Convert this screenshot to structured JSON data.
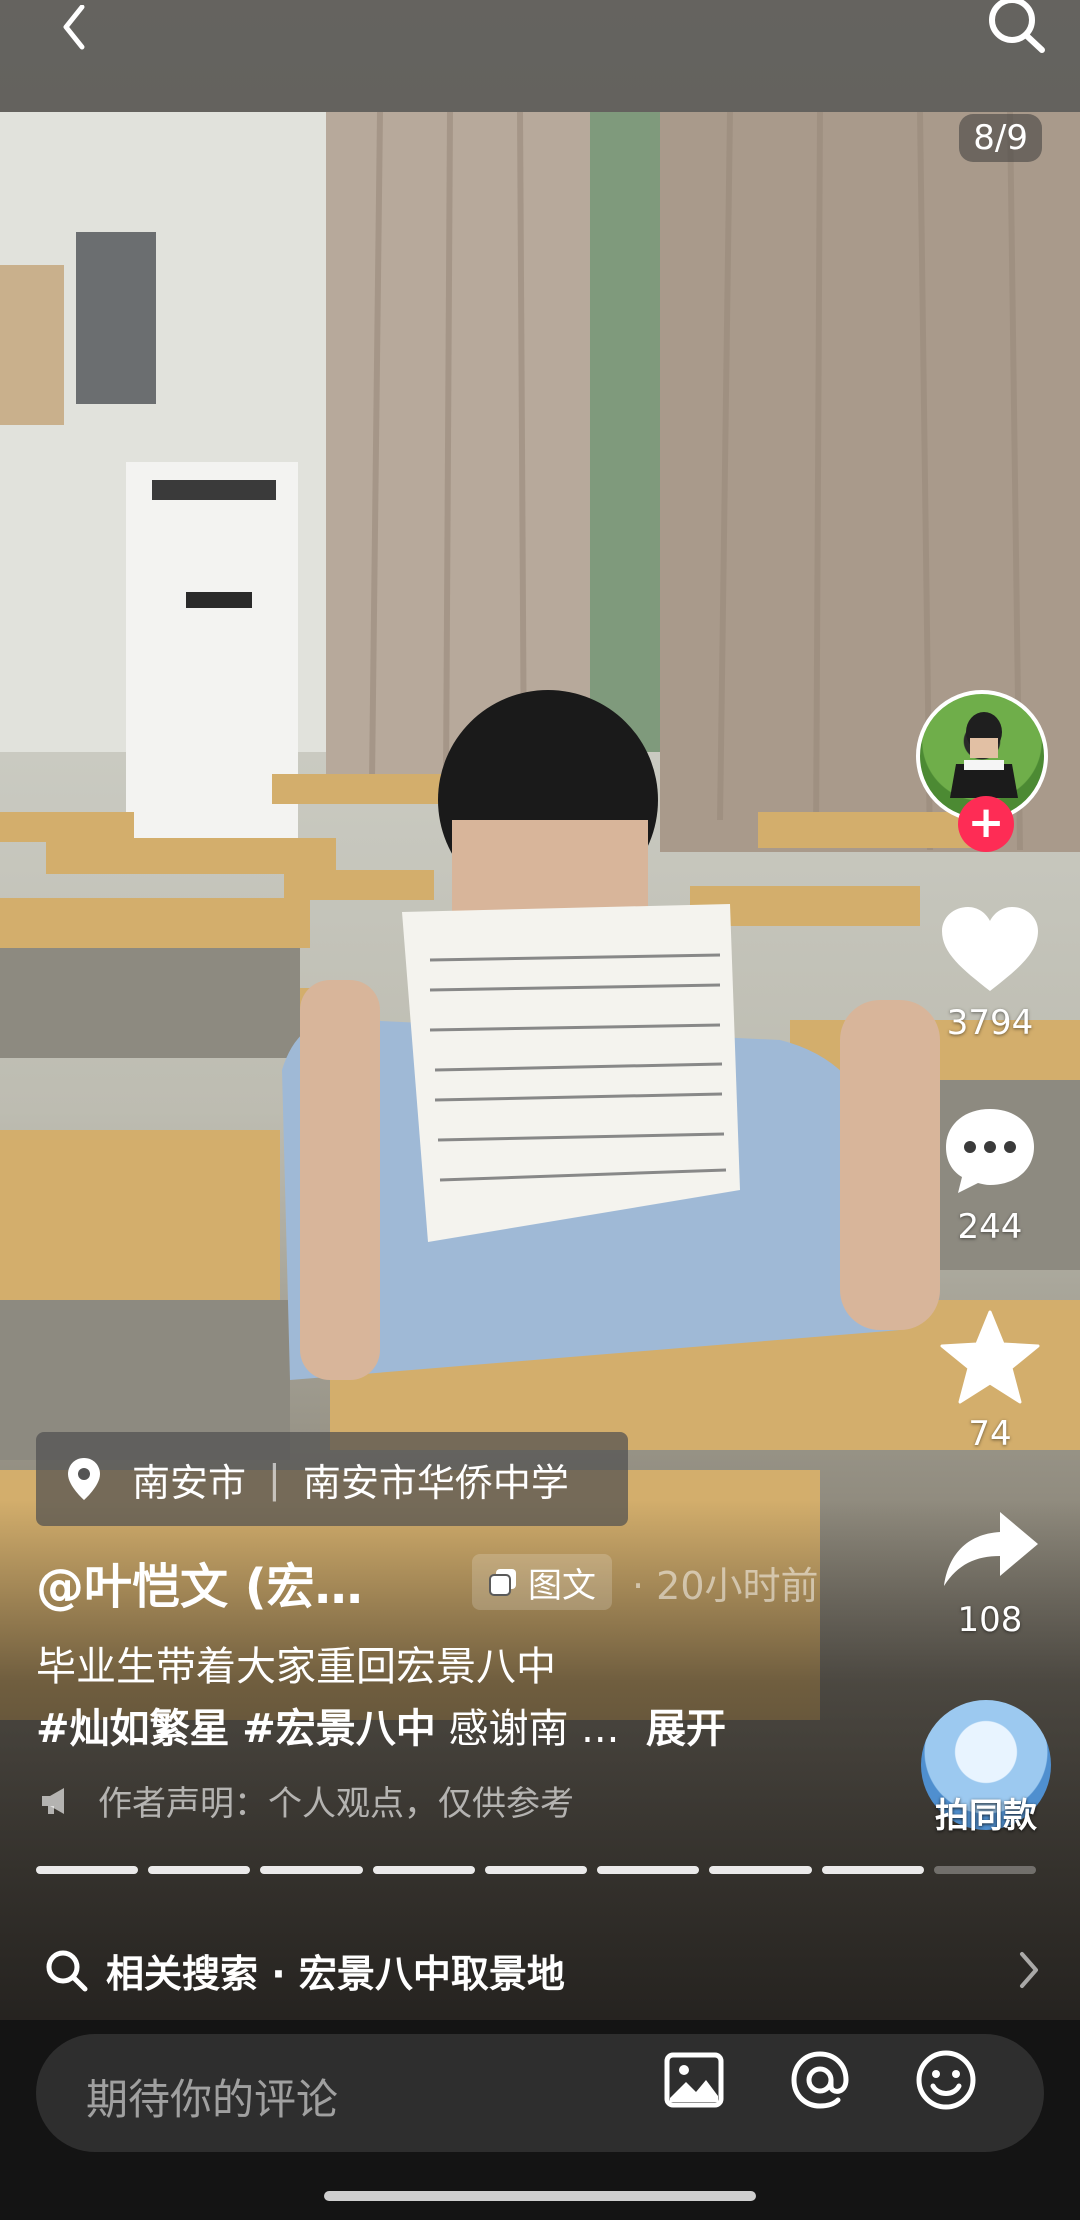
{
  "page_counter": "8/9",
  "location": {
    "city": "南安市",
    "place": "南安市华侨中学"
  },
  "post": {
    "author": "@叶恺文 (宏…",
    "type_tag": "图文",
    "time": "· 20小时前",
    "caption_line1": "毕业生带着大家重回宏景八中",
    "hashtags": [
      "#灿如繁星",
      "#宏景八中"
    ],
    "caption_rest": "感谢南 ...",
    "expand_label": "展开",
    "notice": "作者声明：个人观点，仅供参考"
  },
  "rail": {
    "likes": "3794",
    "comments": "244",
    "favorites": "74",
    "shares": "108",
    "same_style_label": "拍同款"
  },
  "progress": {
    "total": 9,
    "current": 8
  },
  "related_search": {
    "label": "相关搜索 · 宏景八中取景地"
  },
  "comment_bar": {
    "placeholder": "期待你的评论"
  },
  "colors": {
    "follow": "#fe2c55",
    "background": "#121212"
  }
}
